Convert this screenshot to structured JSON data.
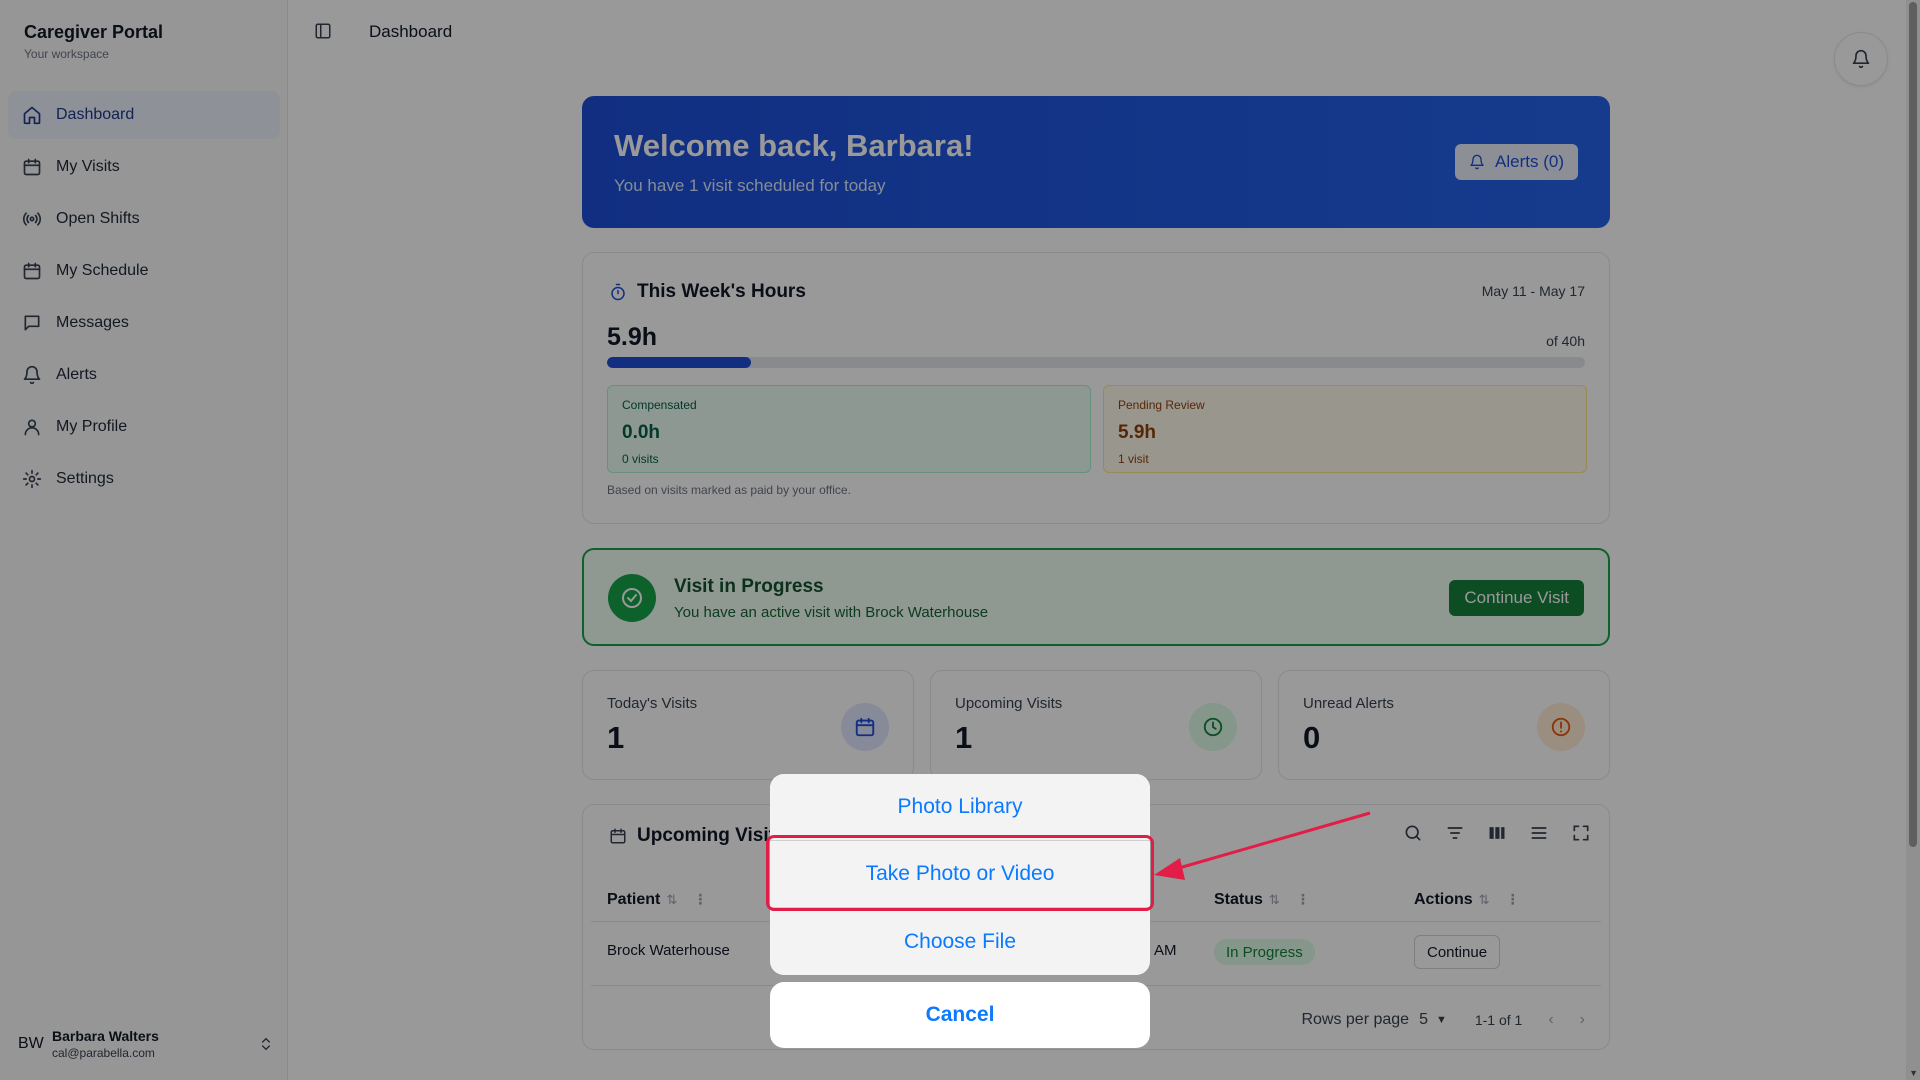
{
  "sidebar": {
    "title": "Caregiver Portal",
    "subtitle": "Your workspace",
    "items": [
      {
        "label": "Dashboard",
        "icon": "home-icon",
        "active": true
      },
      {
        "label": "My Visits",
        "icon": "calendar-icon"
      },
      {
        "label": "Open Shifts",
        "icon": "broadcast-icon"
      },
      {
        "label": "My Schedule",
        "icon": "calendar-icon"
      },
      {
        "label": "Messages",
        "icon": "message-icon"
      },
      {
        "label": "Alerts",
        "icon": "bell-icon"
      },
      {
        "label": "My Profile",
        "icon": "user-icon"
      },
      {
        "label": "Settings",
        "icon": "gear-icon"
      }
    ],
    "user": {
      "initials": "BW",
      "name": "Barbara Walters",
      "email": "cal@parabella.com"
    }
  },
  "topbar": {
    "title": "Dashboard"
  },
  "welcome": {
    "title": "Welcome back, Barbara!",
    "subtitle": "You have 1 visit scheduled for today",
    "alerts_button": "Alerts (0)"
  },
  "hours": {
    "title": "This Week's Hours",
    "range": "May 11 - May 17",
    "value": "5.9h",
    "of": "of 40h",
    "progress_fraction": 0.1475,
    "compensated": {
      "label": "Compensated",
      "value": "0.0h",
      "note": "0 visits"
    },
    "pending": {
      "label": "Pending Review",
      "value": "5.9h",
      "note": "1 visit"
    },
    "footnote": "Based on visits marked as paid by your office."
  },
  "visit_in_progress": {
    "title": "Visit in Progress",
    "subtitle": "You have an active visit with Brock Waterhouse",
    "button": "Continue Visit"
  },
  "stats": [
    {
      "label": "Today's Visits",
      "value": "1",
      "icon": "calendar-icon",
      "color": "#1d4ed8"
    },
    {
      "label": "Upcoming Visits",
      "value": "1",
      "icon": "clock-icon",
      "color": "#15803d"
    },
    {
      "label": "Unread Alerts",
      "value": "0",
      "icon": "alert-circle-icon",
      "color": "#ea580c"
    }
  ],
  "upcoming": {
    "title": "Upcoming Visits",
    "columns": {
      "patient": "Patient",
      "status": "Status",
      "actions": "Actions"
    },
    "rows": [
      {
        "patient": "Brock Waterhouse",
        "time_fragment": "AM",
        "status": "In Progress",
        "action": "Continue"
      }
    ],
    "pagination": {
      "rows_per_page_label": "Rows per page",
      "rows_per_page": "5",
      "count": "1-1 of 1"
    }
  },
  "action_sheet": {
    "options": [
      "Photo Library",
      "Take Photo or Video",
      "Choose File"
    ],
    "cancel": "Cancel"
  },
  "colors": {
    "accent": "#1d4ed8",
    "success": "#15803d",
    "ios_blue": "#0a7aff",
    "annotation": "#e11d48"
  }
}
